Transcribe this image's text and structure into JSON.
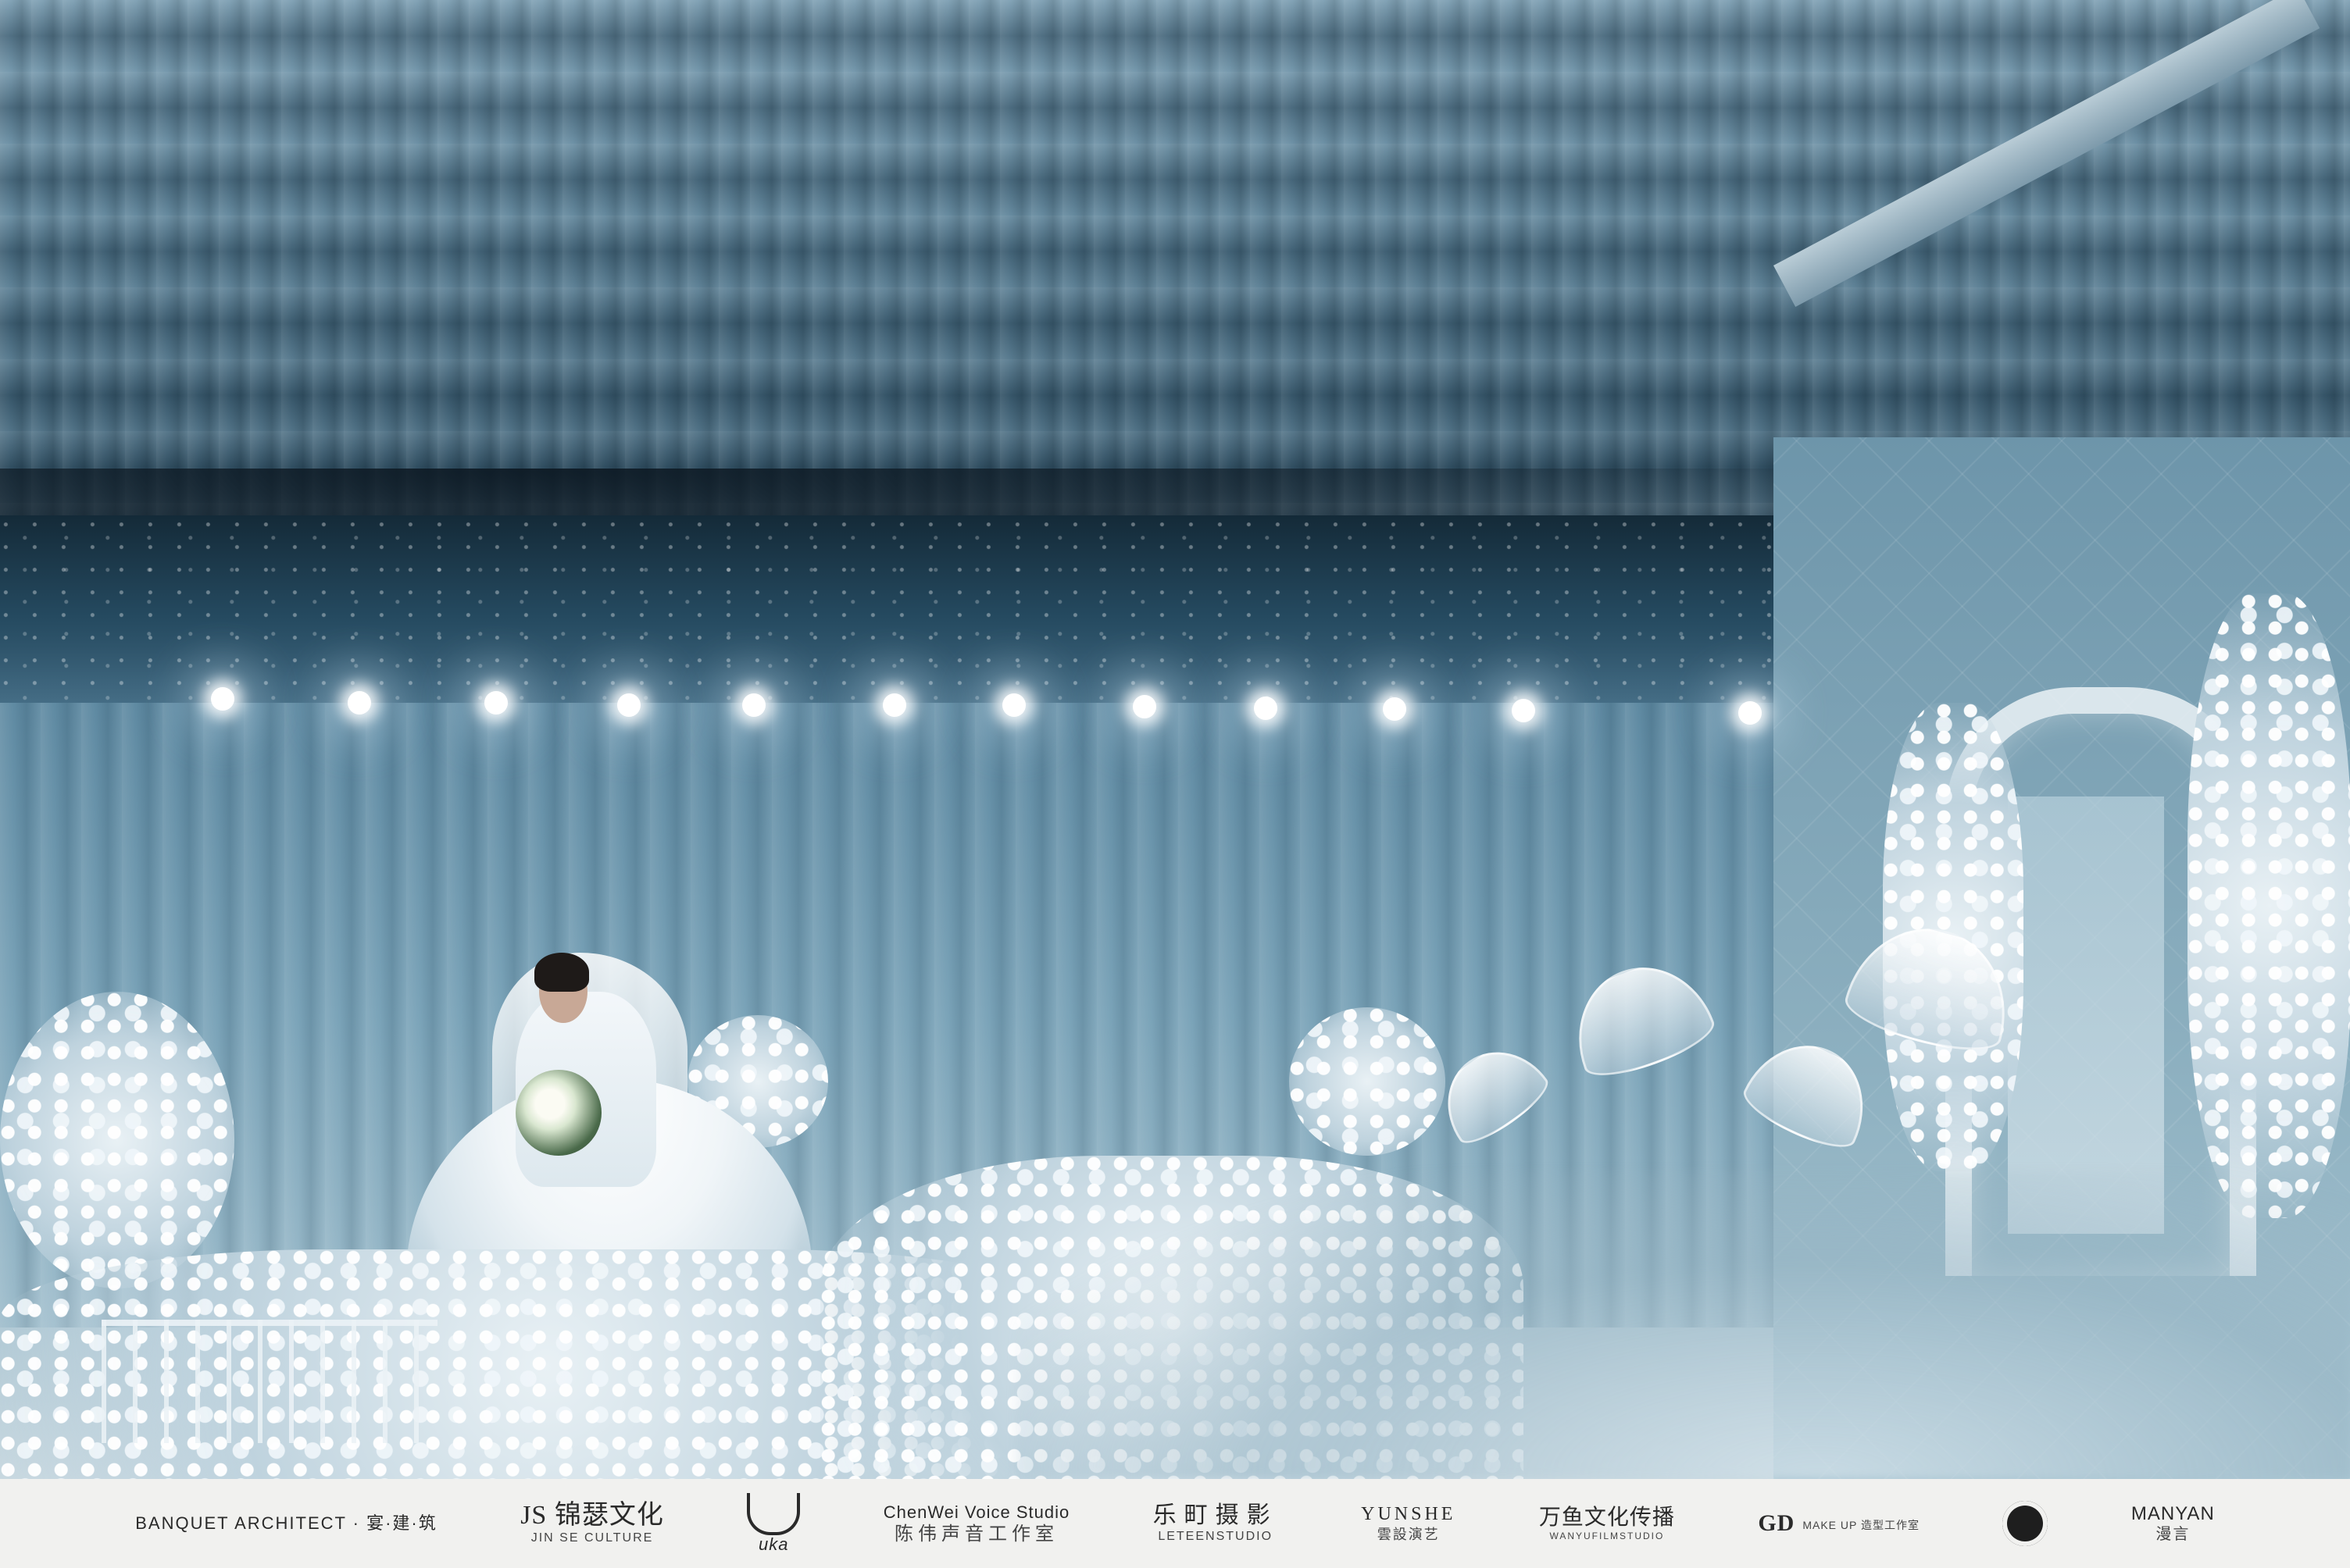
{
  "photo": {
    "description_kind": "wedding-venue-photograph"
  },
  "footer": {
    "logos": [
      {
        "main": "BANQUET ARCHITECT · 宴·建·筑",
        "sub": ""
      },
      {
        "main": "JS 锦瑟文化",
        "sub": "JIN SE CULTURE"
      },
      {
        "main": "uka",
        "sub": ""
      },
      {
        "main": "ChenWei Voice Studio",
        "sub": "陈伟声音工作室"
      },
      {
        "main": "乐町摄影",
        "sub": "LETEENSTUDIO"
      },
      {
        "main": "YUNSHE",
        "sub": "雲設演艺"
      },
      {
        "main": "万鱼文化传播",
        "sub": "WANYUFILMSTUDIO"
      },
      {
        "main": "GD",
        "sub": "MAKE UP 造型工作室"
      },
      {
        "main": "",
        "sub": ""
      },
      {
        "main": "MANYAN",
        "sub": "漫言"
      }
    ]
  }
}
